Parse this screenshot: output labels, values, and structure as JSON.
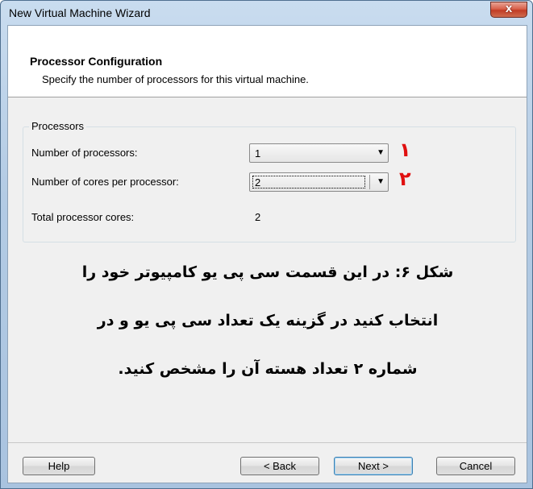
{
  "window": {
    "title": "New Virtual Machine Wizard",
    "close_glyph": "x"
  },
  "header": {
    "title": "Processor Configuration",
    "subtitle": "Specify the number of processors for this virtual machine."
  },
  "processors": {
    "group_label": "Processors",
    "num_processors_label": "Number of processors:",
    "num_processors_value": "1",
    "cores_label": "Number of cores per processor:",
    "cores_value": "2",
    "total_label": "Total processor cores:",
    "total_value": "2"
  },
  "annotations": {
    "marker_1": "۱",
    "marker_2": "۲",
    "color": "#e01010"
  },
  "caption": {
    "line1": "شکل ۶: در این قسمت سی پی یو کامپیوتر خود را",
    "line2": "انتخاب کنید در گزینه یک تعداد سی پی یو و در",
    "line3": "شماره ۲ تعداد هسته آن را مشخص کنید."
  },
  "buttons": {
    "help": "Help",
    "back": "< Back",
    "next": "Next >",
    "cancel": "Cancel"
  },
  "icons": {
    "dropdown": "chevron-down-icon",
    "close": "close-icon"
  }
}
